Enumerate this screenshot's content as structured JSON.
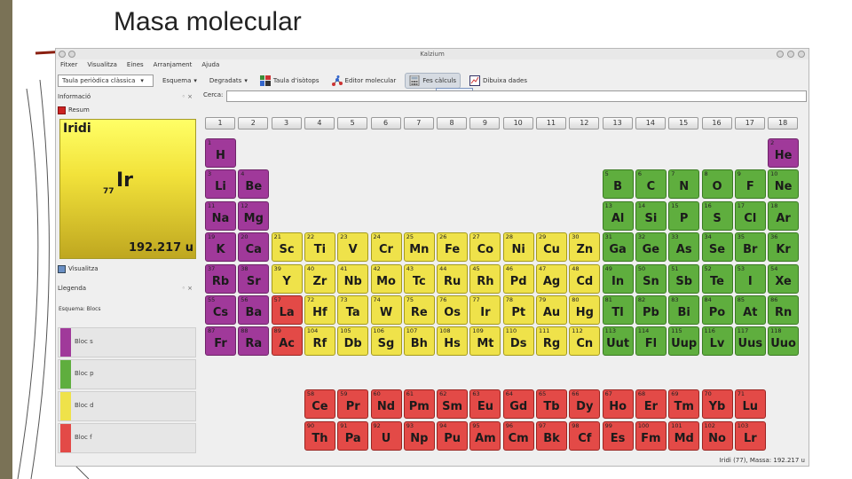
{
  "slide": {
    "title": "Masa molecular"
  },
  "window": {
    "title": "Kalzium"
  },
  "menu": [
    "Fitxer",
    "Visualitza",
    "Eines",
    "Arranjament",
    "Ajuda"
  ],
  "toolbar": {
    "scheme_select": "Taula periòdica clàssica",
    "scheme_label": "Esquema",
    "gradient_label": "Degradats",
    "isotopes_label": "Taula d'isòtops",
    "molecule_editor_label": "Editor molecular",
    "calc_label": "Fes càlculs",
    "plot_label": "Dibuixa dades",
    "tooltip": "Fes càlculs"
  },
  "search": {
    "label": "Cerca:",
    "value": ""
  },
  "panels": {
    "info_title": "Informació",
    "summary_tab": "Resum",
    "view_tab": "Visualitza",
    "legend_title": "Llegenda",
    "legend_scheme": "Esquema: Blocs",
    "legend_items": [
      {
        "label": "Bloc s",
        "color": "#a0399a"
      },
      {
        "label": "Bloc p",
        "color": "#5fae3e"
      },
      {
        "label": "Bloc d",
        "color": "#efe24a"
      },
      {
        "label": "Bloc f",
        "color": "#e34a47"
      }
    ]
  },
  "selected_element": {
    "name": "Iridi",
    "symbol": "Ir",
    "number": "77",
    "mass": "192.217 u"
  },
  "statusbar": "Iridi (77), Massa: 192.217 u",
  "groups": [
    "1",
    "2",
    "3",
    "4",
    "5",
    "6",
    "7",
    "8",
    "9",
    "10",
    "11",
    "12",
    "13",
    "14",
    "15",
    "16",
    "17",
    "18"
  ],
  "elements": [
    {
      "n": "1",
      "s": "H",
      "r": 1,
      "c": 1,
      "b": "s"
    },
    {
      "n": "2",
      "s": "He",
      "r": 1,
      "c": 18,
      "b": "s"
    },
    {
      "n": "3",
      "s": "Li",
      "r": 2,
      "c": 1,
      "b": "s"
    },
    {
      "n": "4",
      "s": "Be",
      "r": 2,
      "c": 2,
      "b": "s"
    },
    {
      "n": "5",
      "s": "B",
      "r": 2,
      "c": 13,
      "b": "p"
    },
    {
      "n": "6",
      "s": "C",
      "r": 2,
      "c": 14,
      "b": "p"
    },
    {
      "n": "7",
      "s": "N",
      "r": 2,
      "c": 15,
      "b": "p"
    },
    {
      "n": "8",
      "s": "O",
      "r": 2,
      "c": 16,
      "b": "p"
    },
    {
      "n": "9",
      "s": "F",
      "r": 2,
      "c": 17,
      "b": "p"
    },
    {
      "n": "10",
      "s": "Ne",
      "r": 2,
      "c": 18,
      "b": "p"
    },
    {
      "n": "11",
      "s": "Na",
      "r": 3,
      "c": 1,
      "b": "s"
    },
    {
      "n": "12",
      "s": "Mg",
      "r": 3,
      "c": 2,
      "b": "s"
    },
    {
      "n": "13",
      "s": "Al",
      "r": 3,
      "c": 13,
      "b": "p"
    },
    {
      "n": "14",
      "s": "Si",
      "r": 3,
      "c": 14,
      "b": "p"
    },
    {
      "n": "15",
      "s": "P",
      "r": 3,
      "c": 15,
      "b": "p"
    },
    {
      "n": "16",
      "s": "S",
      "r": 3,
      "c": 16,
      "b": "p"
    },
    {
      "n": "17",
      "s": "Cl",
      "r": 3,
      "c": 17,
      "b": "p"
    },
    {
      "n": "18",
      "s": "Ar",
      "r": 3,
      "c": 18,
      "b": "p"
    },
    {
      "n": "19",
      "s": "K",
      "r": 4,
      "c": 1,
      "b": "s"
    },
    {
      "n": "20",
      "s": "Ca",
      "r": 4,
      "c": 2,
      "b": "s"
    },
    {
      "n": "21",
      "s": "Sc",
      "r": 4,
      "c": 3,
      "b": "d"
    },
    {
      "n": "22",
      "s": "Ti",
      "r": 4,
      "c": 4,
      "b": "d"
    },
    {
      "n": "23",
      "s": "V",
      "r": 4,
      "c": 5,
      "b": "d"
    },
    {
      "n": "24",
      "s": "Cr",
      "r": 4,
      "c": 6,
      "b": "d"
    },
    {
      "n": "25",
      "s": "Mn",
      "r": 4,
      "c": 7,
      "b": "d"
    },
    {
      "n": "26",
      "s": "Fe",
      "r": 4,
      "c": 8,
      "b": "d"
    },
    {
      "n": "27",
      "s": "Co",
      "r": 4,
      "c": 9,
      "b": "d"
    },
    {
      "n": "28",
      "s": "Ni",
      "r": 4,
      "c": 10,
      "b": "d"
    },
    {
      "n": "29",
      "s": "Cu",
      "r": 4,
      "c": 11,
      "b": "d"
    },
    {
      "n": "30",
      "s": "Zn",
      "r": 4,
      "c": 12,
      "b": "d"
    },
    {
      "n": "31",
      "s": "Ga",
      "r": 4,
      "c": 13,
      "b": "p"
    },
    {
      "n": "32",
      "s": "Ge",
      "r": 4,
      "c": 14,
      "b": "p"
    },
    {
      "n": "33",
      "s": "As",
      "r": 4,
      "c": 15,
      "b": "p"
    },
    {
      "n": "34",
      "s": "Se",
      "r": 4,
      "c": 16,
      "b": "p"
    },
    {
      "n": "35",
      "s": "Br",
      "r": 4,
      "c": 17,
      "b": "p"
    },
    {
      "n": "36",
      "s": "Kr",
      "r": 4,
      "c": 18,
      "b": "p"
    },
    {
      "n": "37",
      "s": "Rb",
      "r": 5,
      "c": 1,
      "b": "s"
    },
    {
      "n": "38",
      "s": "Sr",
      "r": 5,
      "c": 2,
      "b": "s"
    },
    {
      "n": "39",
      "s": "Y",
      "r": 5,
      "c": 3,
      "b": "d"
    },
    {
      "n": "40",
      "s": "Zr",
      "r": 5,
      "c": 4,
      "b": "d"
    },
    {
      "n": "41",
      "s": "Nb",
      "r": 5,
      "c": 5,
      "b": "d"
    },
    {
      "n": "42",
      "s": "Mo",
      "r": 5,
      "c": 6,
      "b": "d"
    },
    {
      "n": "43",
      "s": "Tc",
      "r": 5,
      "c": 7,
      "b": "d"
    },
    {
      "n": "44",
      "s": "Ru",
      "r": 5,
      "c": 8,
      "b": "d"
    },
    {
      "n": "45",
      "s": "Rh",
      "r": 5,
      "c": 9,
      "b": "d"
    },
    {
      "n": "46",
      "s": "Pd",
      "r": 5,
      "c": 10,
      "b": "d"
    },
    {
      "n": "47",
      "s": "Ag",
      "r": 5,
      "c": 11,
      "b": "d"
    },
    {
      "n": "48",
      "s": "Cd",
      "r": 5,
      "c": 12,
      "b": "d"
    },
    {
      "n": "49",
      "s": "In",
      "r": 5,
      "c": 13,
      "b": "p"
    },
    {
      "n": "50",
      "s": "Sn",
      "r": 5,
      "c": 14,
      "b": "p"
    },
    {
      "n": "51",
      "s": "Sb",
      "r": 5,
      "c": 15,
      "b": "p"
    },
    {
      "n": "52",
      "s": "Te",
      "r": 5,
      "c": 16,
      "b": "p"
    },
    {
      "n": "53",
      "s": "I",
      "r": 5,
      "c": 17,
      "b": "p"
    },
    {
      "n": "54",
      "s": "Xe",
      "r": 5,
      "c": 18,
      "b": "p"
    },
    {
      "n": "55",
      "s": "Cs",
      "r": 6,
      "c": 1,
      "b": "s"
    },
    {
      "n": "56",
      "s": "Ba",
      "r": 6,
      "c": 2,
      "b": "s"
    },
    {
      "n": "57",
      "s": "La",
      "r": 6,
      "c": 3,
      "b": "f"
    },
    {
      "n": "72",
      "s": "Hf",
      "r": 6,
      "c": 4,
      "b": "d"
    },
    {
      "n": "73",
      "s": "Ta",
      "r": 6,
      "c": 5,
      "b": "d"
    },
    {
      "n": "74",
      "s": "W",
      "r": 6,
      "c": 6,
      "b": "d"
    },
    {
      "n": "75",
      "s": "Re",
      "r": 6,
      "c": 7,
      "b": "d"
    },
    {
      "n": "76",
      "s": "Os",
      "r": 6,
      "c": 8,
      "b": "d"
    },
    {
      "n": "77",
      "s": "Ir",
      "r": 6,
      "c": 9,
      "b": "d"
    },
    {
      "n": "78",
      "s": "Pt",
      "r": 6,
      "c": 10,
      "b": "d"
    },
    {
      "n": "79",
      "s": "Au",
      "r": 6,
      "c": 11,
      "b": "d"
    },
    {
      "n": "80",
      "s": "Hg",
      "r": 6,
      "c": 12,
      "b": "d"
    },
    {
      "n": "81",
      "s": "Tl",
      "r": 6,
      "c": 13,
      "b": "p"
    },
    {
      "n": "82",
      "s": "Pb",
      "r": 6,
      "c": 14,
      "b": "p"
    },
    {
      "n": "83",
      "s": "Bi",
      "r": 6,
      "c": 15,
      "b": "p"
    },
    {
      "n": "84",
      "s": "Po",
      "r": 6,
      "c": 16,
      "b": "p"
    },
    {
      "n": "85",
      "s": "At",
      "r": 6,
      "c": 17,
      "b": "p"
    },
    {
      "n": "86",
      "s": "Rn",
      "r": 6,
      "c": 18,
      "b": "p"
    },
    {
      "n": "87",
      "s": "Fr",
      "r": 7,
      "c": 1,
      "b": "s"
    },
    {
      "n": "88",
      "s": "Ra",
      "r": 7,
      "c": 2,
      "b": "s"
    },
    {
      "n": "89",
      "s": "Ac",
      "r": 7,
      "c": 3,
      "b": "f"
    },
    {
      "n": "104",
      "s": "Rf",
      "r": 7,
      "c": 4,
      "b": "d"
    },
    {
      "n": "105",
      "s": "Db",
      "r": 7,
      "c": 5,
      "b": "d"
    },
    {
      "n": "106",
      "s": "Sg",
      "r": 7,
      "c": 6,
      "b": "d"
    },
    {
      "n": "107",
      "s": "Bh",
      "r": 7,
      "c": 7,
      "b": "d"
    },
    {
      "n": "108",
      "s": "Hs",
      "r": 7,
      "c": 8,
      "b": "d"
    },
    {
      "n": "109",
      "s": "Mt",
      "r": 7,
      "c": 9,
      "b": "d"
    },
    {
      "n": "110",
      "s": "Ds",
      "r": 7,
      "c": 10,
      "b": "d"
    },
    {
      "n": "111",
      "s": "Rg",
      "r": 7,
      "c": 11,
      "b": "d"
    },
    {
      "n": "112",
      "s": "Cn",
      "r": 7,
      "c": 12,
      "b": "d"
    },
    {
      "n": "113",
      "s": "Uut",
      "r": 7,
      "c": 13,
      "b": "p"
    },
    {
      "n": "114",
      "s": "Fl",
      "r": 7,
      "c": 14,
      "b": "p"
    },
    {
      "n": "115",
      "s": "Uup",
      "r": 7,
      "c": 15,
      "b": "p"
    },
    {
      "n": "116",
      "s": "Lv",
      "r": 7,
      "c": 16,
      "b": "p"
    },
    {
      "n": "117",
      "s": "Uus",
      "r": 7,
      "c": 17,
      "b": "p"
    },
    {
      "n": "118",
      "s": "Uuo",
      "r": 7,
      "c": 18,
      "b": "p"
    },
    {
      "n": "58",
      "s": "Ce",
      "r": 9,
      "c": 4,
      "b": "f"
    },
    {
      "n": "59",
      "s": "Pr",
      "r": 9,
      "c": 5,
      "b": "f"
    },
    {
      "n": "60",
      "s": "Nd",
      "r": 9,
      "c": 6,
      "b": "f"
    },
    {
      "n": "61",
      "s": "Pm",
      "r": 9,
      "c": 7,
      "b": "f"
    },
    {
      "n": "62",
      "s": "Sm",
      "r": 9,
      "c": 8,
      "b": "f"
    },
    {
      "n": "63",
      "s": "Eu",
      "r": 9,
      "c": 9,
      "b": "f"
    },
    {
      "n": "64",
      "s": "Gd",
      "r": 9,
      "c": 10,
      "b": "f"
    },
    {
      "n": "65",
      "s": "Tb",
      "r": 9,
      "c": 11,
      "b": "f"
    },
    {
      "n": "66",
      "s": "Dy",
      "r": 9,
      "c": 12,
      "b": "f"
    },
    {
      "n": "67",
      "s": "Ho",
      "r": 9,
      "c": 13,
      "b": "f"
    },
    {
      "n": "68",
      "s": "Er",
      "r": 9,
      "c": 14,
      "b": "f"
    },
    {
      "n": "69",
      "s": "Tm",
      "r": 9,
      "c": 15,
      "b": "f"
    },
    {
      "n": "70",
      "s": "Yb",
      "r": 9,
      "c": 16,
      "b": "f"
    },
    {
      "n": "71",
      "s": "Lu",
      "r": 9,
      "c": 17,
      "b": "f"
    },
    {
      "n": "90",
      "s": "Th",
      "r": 10,
      "c": 4,
      "b": "f"
    },
    {
      "n": "91",
      "s": "Pa",
      "r": 10,
      "c": 5,
      "b": "f"
    },
    {
      "n": "92",
      "s": "U",
      "r": 10,
      "c": 6,
      "b": "f"
    },
    {
      "n": "93",
      "s": "Np",
      "r": 10,
      "c": 7,
      "b": "f"
    },
    {
      "n": "94",
      "s": "Pu",
      "r": 10,
      "c": 8,
      "b": "f"
    },
    {
      "n": "95",
      "s": "Am",
      "r": 10,
      "c": 9,
      "b": "f"
    },
    {
      "n": "96",
      "s": "Cm",
      "r": 10,
      "c": 10,
      "b": "f"
    },
    {
      "n": "97",
      "s": "Bk",
      "r": 10,
      "c": 11,
      "b": "f"
    },
    {
      "n": "98",
      "s": "Cf",
      "r": 10,
      "c": 12,
      "b": "f"
    },
    {
      "n": "99",
      "s": "Es",
      "r": 10,
      "c": 13,
      "b": "f"
    },
    {
      "n": "100",
      "s": "Fm",
      "r": 10,
      "c": 14,
      "b": "f"
    },
    {
      "n": "101",
      "s": "Md",
      "r": 10,
      "c": 15,
      "b": "f"
    },
    {
      "n": "102",
      "s": "No",
      "r": 10,
      "c": 16,
      "b": "f"
    },
    {
      "n": "103",
      "s": "Lr",
      "r": 10,
      "c": 17,
      "b": "f"
    }
  ]
}
